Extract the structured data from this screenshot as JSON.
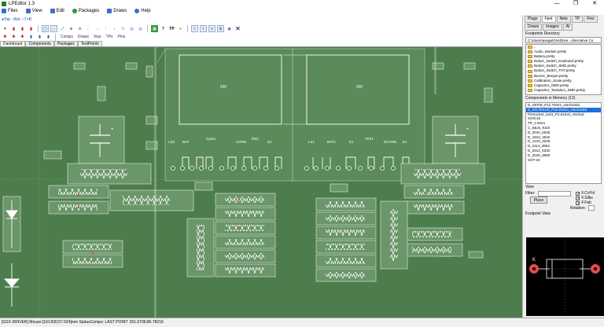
{
  "window": {
    "title": "LPEditor 1.3",
    "minimize": "—",
    "maximize": "❐",
    "close": "✕"
  },
  "menu": [
    {
      "label": "Files",
      "color": "#3a6fc4"
    },
    {
      "label": "View",
      "color": "#3a6fc4"
    },
    {
      "label": "Edit",
      "color": "#3a6fc4"
    },
    {
      "label": "Packages",
      "color": "#2e9a2e"
    },
    {
      "label": "Draws",
      "color": "#3a6fc4"
    },
    {
      "label": "Help",
      "color": "#3a6fc4"
    }
  ],
  "layers": {
    "top": "Top",
    "bot": "Bot",
    "tb": "T+B"
  },
  "toolbar3": {
    "comps": "Comps",
    "draws": "Draws",
    "vias": "Vias",
    "tps": "TPs",
    "pins": "Pins"
  },
  "doc_tabs": [
    "Dashboard",
    "Components",
    "Packages",
    "TestPoints"
  ],
  "board": {
    "silkscreen": [
      "LS2",
      "BAT",
      "Gpin2",
      "CONN",
      "RS2",
      "E2",
      "LS1",
      "BAT1",
      "E1",
      "Vtrh1",
      "ECONN",
      "E1"
    ],
    "pad_labels": [
      "001",
      "001"
    ]
  },
  "right_tabs": [
    "Plugs",
    "Fpnt",
    "Nets",
    "TP",
    "Fins",
    "Draws",
    "Images",
    "AI"
  ],
  "footprint_dir": {
    "label": "Footprints Directory",
    "path": "C:\\Users\\avega\\OneDrive - Alternative Co",
    "items": [
      "..",
      "Audio_Module.pretty",
      "Battery.pretty",
      "Button_Switch_Keyboard.pretty",
      "Button_Switch_SMD.pretty",
      "Button_Switch_THT.pretty",
      "Buzzer_Beeper.pretty",
      "Calibration_Scale.pretty",
      "Capacitor_SMD.pretty",
      "Capacitor_Tantalum_SMD.pretty"
    ]
  },
  "memory": {
    "label": "Components in Memory (13)",
    "items": [
      "D_SKFW_P12.70mm_Horizontal",
      "D_DO-201AD_P15.24mm_Horizontal",
      "PinSocket_1x01_P2.54mm_Vertical",
      "SOIC16",
      "TP_1.5mm",
      "C_5&x5_9110",
      "D_2010_5025",
      "D_1812_4532",
      "D_1210_3225",
      "D_2114_3652",
      "D_2512_6332",
      "D_3225_8050",
      "SOT-23"
    ],
    "selected_index": 1
  },
  "view_panel": {
    "label": "View",
    "filter_label": "Filter:",
    "place_label": "Place",
    "checks": [
      {
        "label": "F.CrtYd",
        "checked": true
      },
      {
        "label": "F.Silks",
        "checked": true
      },
      {
        "label": "F.Fab",
        "checked": true
      }
    ],
    "rotation_label": "Rotation:"
  },
  "footprint_view": {
    "label": "Footprint View",
    "ref": "K"
  },
  "status": "[GSX-DRIVER]  Mouse:[110.830;57.024]mm  StatusComps:  LAST POINT: 301.6706;86.78216",
  "colors": {
    "board": "#4d7d4d",
    "copper": "#7fae7f",
    "outline": "#ffffff",
    "pad_red": "#e24b4b"
  }
}
